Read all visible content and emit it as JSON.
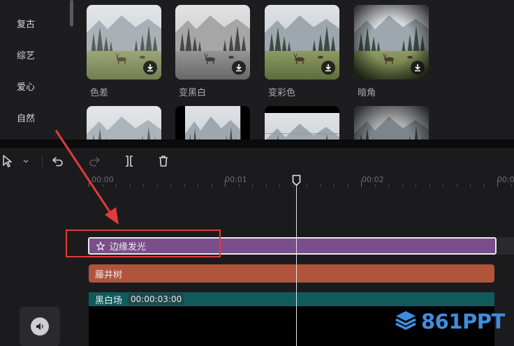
{
  "categories": [
    "复古",
    "综艺",
    "爱心",
    "自然"
  ],
  "effects": [
    {
      "label": "色差"
    },
    {
      "label": "变黑白"
    },
    {
      "label": "变彩色"
    },
    {
      "label": "暗角"
    }
  ],
  "toolbar": {
    "select_icon": "pointer-icon",
    "undo_icon": "undo-icon",
    "redo_icon": "redo-icon",
    "split_icon": "split-icon",
    "delete_icon": "trash-icon"
  },
  "ruler": {
    "labels": [
      "00:00",
      "00:01",
      "00:02",
      "00:0"
    ]
  },
  "tracks": {
    "effect_clip": "边缘发光",
    "filter_clip": "藤井树",
    "video_clip": "黑白场",
    "video_duration": "00:00:03:00"
  },
  "watermark": "861PPT",
  "colors": {
    "accent_highlight": "#e33a3a",
    "effect_clip": "#7a4e8a",
    "filter_clip": "#b0553b",
    "video_header": "#0f5b5c",
    "watermark": "#3f8de0"
  }
}
